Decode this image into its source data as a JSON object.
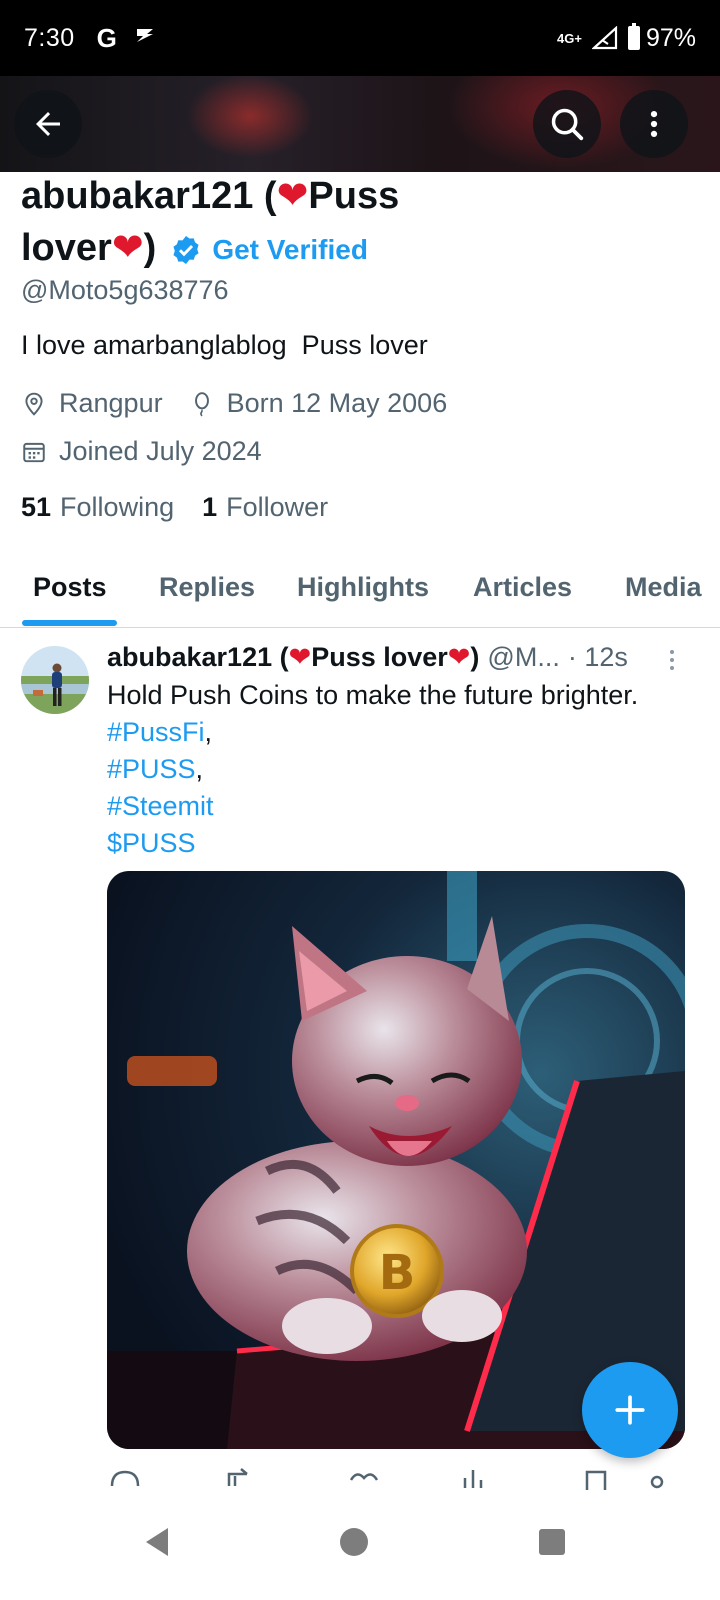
{
  "status_bar": {
    "time": "7:30",
    "g_label": "G",
    "network": "4G+",
    "battery": "97%"
  },
  "profile": {
    "display_name_parts": [
      "abubakar121 (",
      "Puss",
      "lover",
      ")"
    ],
    "get_verified": "Get Verified",
    "handle": "@Moto5g638776",
    "bio": "I love amarbanglablog  Puss lover",
    "location": "Rangpur",
    "born": "Born 12 May 2006",
    "joined": "Joined July 2024",
    "following_count": "51",
    "following_label": "Following",
    "followers_count": "1",
    "followers_label": "Follower"
  },
  "tabs": [
    {
      "label": "Posts",
      "active": true
    },
    {
      "label": "Replies",
      "active": false
    },
    {
      "label": "Highlights",
      "active": false
    },
    {
      "label": "Articles",
      "active": false
    },
    {
      "label": "Media",
      "active": false
    }
  ],
  "post": {
    "author_parts": [
      "abubakar121 (",
      "Puss lover",
      ")"
    ],
    "handle": "@M...",
    "time": "· 12s",
    "text": "Hold Push Coins to make the future brighter.",
    "tags": [
      "#PussFi",
      "#PUSS",
      "#Steemit",
      "$PUSS"
    ],
    "tag_separators": [
      ",",
      ",",
      "",
      ""
    ]
  },
  "colors": {
    "accent": "#1d9bf0",
    "heart": "#e0182d",
    "secondary_text": "#536471",
    "status_bar": "#000000"
  },
  "icons": [
    "back-arrow-icon",
    "search-icon",
    "more-vertical-icon",
    "location-icon",
    "balloon-icon",
    "calendar-icon",
    "verified-badge-icon",
    "plus-icon"
  ]
}
